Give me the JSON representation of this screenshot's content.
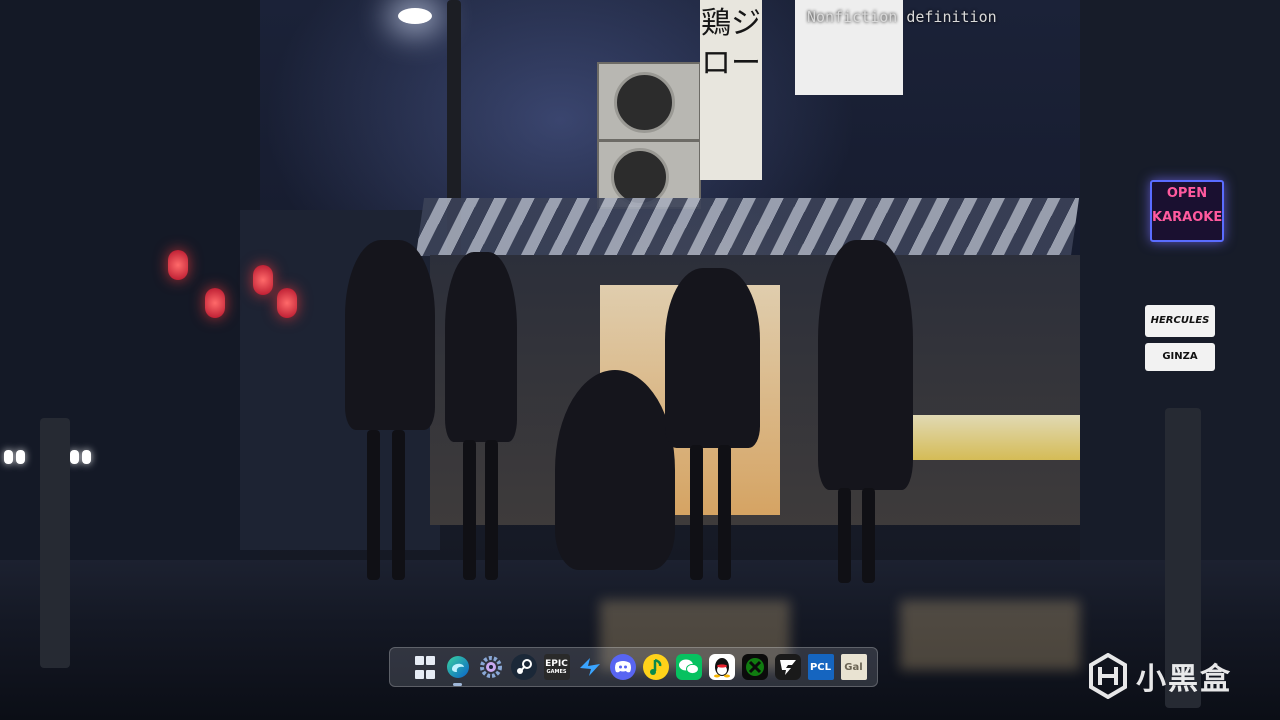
{
  "window": {
    "title_text": "Nonfiction definition"
  },
  "wallpaper": {
    "banner_text": "鶏ジロー",
    "neon_sign": [
      "OPEN",
      "KARAOKE"
    ],
    "store_sign_1": "HERCULES",
    "store_sign_2": "GINZA"
  },
  "taskbar": {
    "items": [
      {
        "name": "Start",
        "icon": "windows-start-icon"
      },
      {
        "name": "Microsoft Edge",
        "icon": "edge-icon"
      },
      {
        "name": "Settings",
        "icon": "gear-icon"
      },
      {
        "name": "Steam",
        "icon": "steam-icon"
      },
      {
        "name": "Epic Games Launcher",
        "icon": "epic-games-icon",
        "label_top": "EPIC",
        "label_bottom": "GAMES"
      },
      {
        "name": "Xunlei",
        "icon": "xunlei-bird-icon"
      },
      {
        "name": "Discord",
        "icon": "discord-icon"
      },
      {
        "name": "QQ Music",
        "icon": "qq-music-icon"
      },
      {
        "name": "WeChat",
        "icon": "wechat-icon"
      },
      {
        "name": "QQ",
        "icon": "qq-penguin-icon"
      },
      {
        "name": "Xbox",
        "icon": "xbox-icon"
      },
      {
        "name": "GameViewer",
        "icon": "lightning-g-icon"
      },
      {
        "name": "PCL",
        "icon": "pcl-launcher-icon",
        "label": "PCL"
      },
      {
        "name": "Gal",
        "icon": "gal-app-icon",
        "label": "Gal"
      }
    ]
  },
  "watermark": {
    "text": "小黑盒",
    "icon": "xiaoheihe-logo-icon"
  },
  "colors": {
    "taskbar_bg": "#dce1eb29",
    "epic": "#2a2a2a",
    "discord": "#5865f2",
    "wechat": "#07c160",
    "qq_music": "#ffd21a",
    "xbox": "#107c10",
    "pcl": "#1565c0"
  }
}
